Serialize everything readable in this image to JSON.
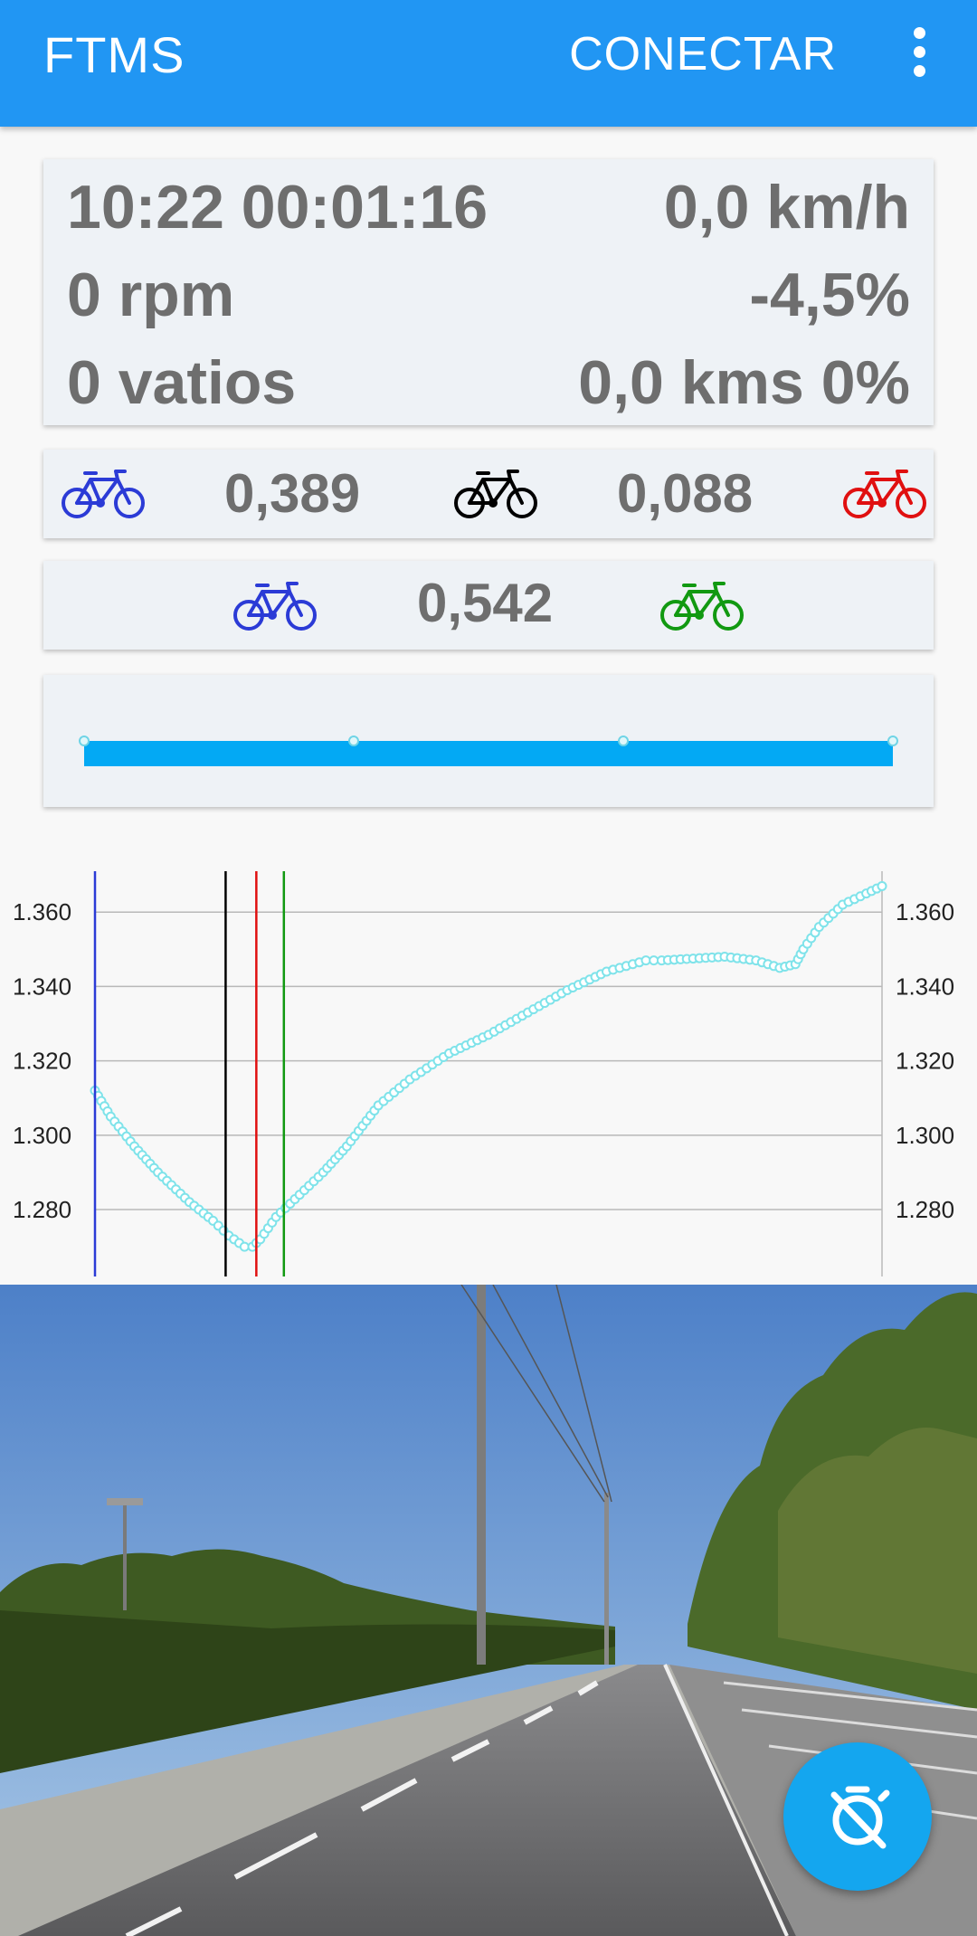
{
  "appbar": {
    "title": "FTMS",
    "connect_label": "CONECTAR",
    "menu_icon": "more-vert-icon",
    "color": "#2196F3"
  },
  "stats": {
    "clock": "10:22 00:01:16",
    "speed": "0,0 km/h",
    "cadence": "0 rpm",
    "grade": "-4,5%",
    "power": "0 vatios",
    "distance": "0,0 kms 0%"
  },
  "gaps1": {
    "left_value": "0,389",
    "right_value": "0,088",
    "icons": [
      "bike-blue-icon",
      "bike-black-icon",
      "bike-red-icon"
    ],
    "colors": [
      "#2b3bd6",
      "#000000",
      "#e01010"
    ]
  },
  "gaps2": {
    "value": "0,542",
    "icons": [
      "bike-blue-icon",
      "bike-green-icon"
    ],
    "colors": [
      "#2b3bd6",
      "#119911"
    ]
  },
  "progress": {
    "fraction": 1.0,
    "checkpoints": [
      0,
      0.3333,
      0.6667,
      1.0
    ],
    "color": "#03a9f4"
  },
  "chart_data": {
    "type": "line",
    "title": "",
    "xlabel": "",
    "ylabel": "",
    "ylim": [
      1262,
      1371
    ],
    "yticks": [
      "1.360",
      "1.340",
      "1.320",
      "1.300",
      "1.280"
    ],
    "ytick_values": [
      1360,
      1340,
      1320,
      1300,
      1280
    ],
    "xlim": [
      0,
      1
    ],
    "grid": true,
    "series": [
      {
        "color": "#7fe3ea",
        "x": [
          0,
          0.02,
          0.05,
          0.08,
          0.12,
          0.15,
          0.17,
          0.19,
          0.2,
          0.21,
          0.23,
          0.26,
          0.29,
          0.32,
          0.36,
          0.4,
          0.45,
          0.5,
          0.55,
          0.6,
          0.65,
          0.7,
          0.72,
          0.8,
          0.84,
          0.87,
          0.89,
          0.9,
          0.92,
          0.95,
          0.98,
          1.0
        ],
        "y": [
          1312,
          1305,
          1297,
          1290,
          1282,
          1277,
          1273,
          1270,
          1270,
          1272,
          1278,
          1284,
          1290,
          1297,
          1308,
          1315,
          1322,
          1327,
          1333,
          1339,
          1344,
          1347,
          1347,
          1348,
          1347,
          1345,
          1346,
          1350,
          1356,
          1362,
          1365,
          1367
        ]
      }
    ],
    "markers": [
      {
        "x": 0.0,
        "color": "#2b3bd6"
      },
      {
        "x": 0.166,
        "color": "#000000"
      },
      {
        "x": 0.205,
        "color": "#e01010"
      },
      {
        "x": 0.24,
        "color": "#119911"
      }
    ]
  },
  "fab": {
    "icon": "timer-off-icon",
    "color": "#14a6ef"
  }
}
